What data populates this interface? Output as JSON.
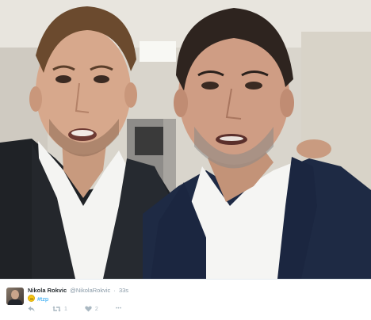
{
  "tweet": {
    "display_name": "Nikola Rokvic",
    "handle": "@NikolaRokvic",
    "separator": "·",
    "time": "33s",
    "hashtag": "#tzp",
    "retweet_count": "1",
    "like_count": "2",
    "more_label": "•••"
  },
  "colors": {
    "link": "#1da1f2",
    "muted": "#8899a6",
    "name": "#292f33",
    "icon": "#aab8c2"
  },
  "icons": [
    "reply-icon",
    "retweet-icon",
    "like-icon",
    "more-icon"
  ]
}
